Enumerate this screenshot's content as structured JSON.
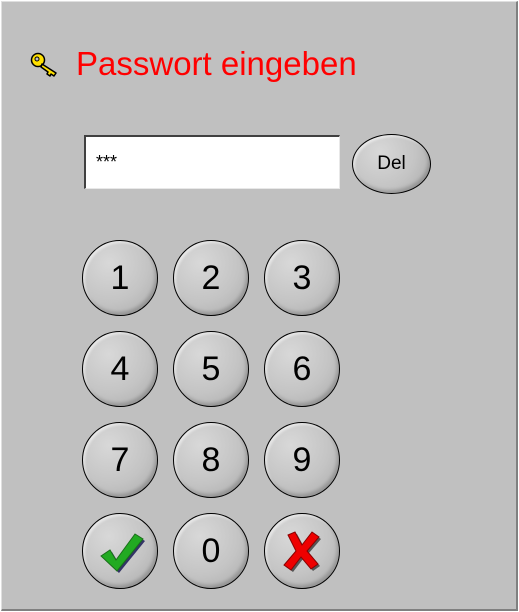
{
  "dialog": {
    "title": "Passwort eingeben",
    "title_color": "#ff0000",
    "icon": "key-icon",
    "icon_color": "#ffe000"
  },
  "password_field": {
    "value": "***"
  },
  "delete_button": {
    "label": "Del"
  },
  "keypad": {
    "keys": [
      "1",
      "2",
      "3",
      "4",
      "5",
      "6",
      "7",
      "8",
      "9",
      "0"
    ],
    "confirm_icon": "checkmark-icon",
    "confirm_color": "#22aa22",
    "cancel_icon": "cross-icon",
    "cancel_color": "#ff0000"
  }
}
